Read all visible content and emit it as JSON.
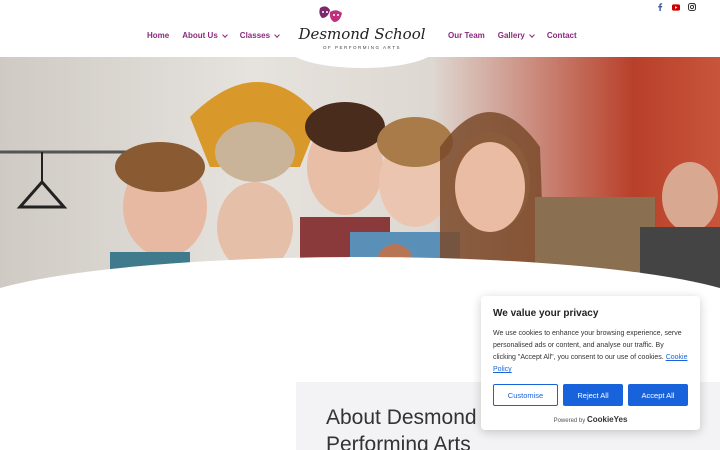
{
  "header": {
    "nav_left": [
      {
        "label": "Home",
        "has_dropdown": false
      },
      {
        "label": "About Us",
        "has_dropdown": true
      },
      {
        "label": "Classes",
        "has_dropdown": true
      }
    ],
    "nav_right": [
      {
        "label": "Our Team",
        "has_dropdown": false
      },
      {
        "label": "Gallery",
        "has_dropdown": true
      },
      {
        "label": "Contact",
        "has_dropdown": false
      }
    ],
    "logo": {
      "title": "Desmond School",
      "subtitle": "OF PERFORMING ARTS"
    },
    "social_icons": [
      "facebook-icon",
      "youtube-icon",
      "instagram-icon"
    ]
  },
  "hero": {
    "slide_count": 4,
    "active_slide": 1
  },
  "about": {
    "title_line1": "About Desmond",
    "title_line2": "Performing Arts"
  },
  "cookie_banner": {
    "title": "We value your privacy",
    "text": "We use cookies to enhance your browsing experience, serve personalised ads or content, and analyse our traffic. By clicking \"Accept All\", you consent to our use of cookies.",
    "link_label": "Cookie Policy",
    "customise_label": "Customise",
    "reject_label": "Reject All",
    "accept_label": "Accept All",
    "powered_by": "Powered by",
    "brand": "CookieYes"
  },
  "colors": {
    "nav": "#8a2a7c",
    "cookie_primary": "#1863dc"
  }
}
